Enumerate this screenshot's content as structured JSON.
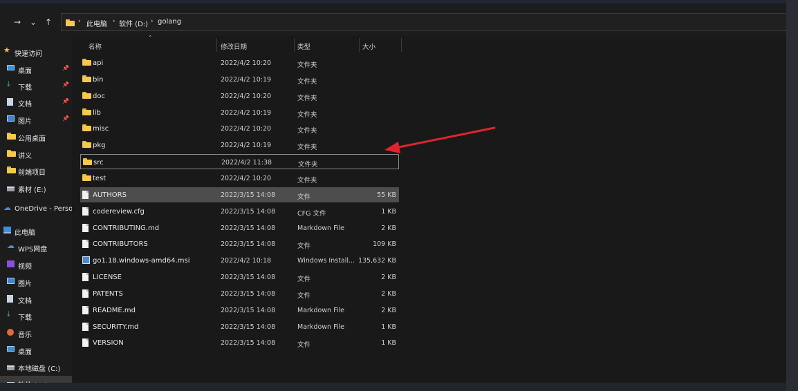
{
  "nav": {
    "back_icon": "arrow-right",
    "recent_icon": "chevron-down",
    "up_icon": "arrow-up"
  },
  "address": {
    "segments": [
      "此电脑",
      "软件 (D:)",
      "golang"
    ]
  },
  "sidebar": {
    "items": [
      {
        "label": "快速访问",
        "icon": "star"
      },
      {
        "label": "桌面",
        "icon": "desktop",
        "pinned": "📌"
      },
      {
        "label": "下载",
        "icon": "download",
        "pinned": "📌"
      },
      {
        "label": "文档",
        "icon": "document",
        "pinned": "📌"
      },
      {
        "label": "图片",
        "icon": "picture",
        "pinned": "📌"
      },
      {
        "label": "公用桌面",
        "icon": "folder"
      },
      {
        "label": "讲义",
        "icon": "folder"
      },
      {
        "label": "前端项目",
        "icon": "folder"
      },
      {
        "label": "素材 (E:)",
        "icon": "drive"
      },
      {
        "label": "OneDrive - Persor",
        "icon": "cloud"
      },
      {
        "label": "此电脑",
        "icon": "computer"
      },
      {
        "label": "WPS网盘",
        "icon": "cloud"
      },
      {
        "label": "视频",
        "icon": "video"
      },
      {
        "label": "图片",
        "icon": "picture"
      },
      {
        "label": "文档",
        "icon": "document"
      },
      {
        "label": "下载",
        "icon": "download"
      },
      {
        "label": "音乐",
        "icon": "music"
      },
      {
        "label": "桌面",
        "icon": "desktop"
      },
      {
        "label": "本地磁盘 (C:)",
        "icon": "drive"
      },
      {
        "label": "软件 (D:)",
        "icon": "drive"
      }
    ]
  },
  "columns": {
    "name": "名称",
    "date": "修改日期",
    "type": "类型",
    "size": "大小"
  },
  "files": [
    {
      "name": "api",
      "date": "2022/4/2 10:20",
      "type": "文件夹",
      "size": "",
      "kind": "folder"
    },
    {
      "name": "bin",
      "date": "2022/4/2 10:19",
      "type": "文件夹",
      "size": "",
      "kind": "folder"
    },
    {
      "name": "doc",
      "date": "2022/4/2 10:20",
      "type": "文件夹",
      "size": "",
      "kind": "folder"
    },
    {
      "name": "lib",
      "date": "2022/4/2 10:19",
      "type": "文件夹",
      "size": "",
      "kind": "folder"
    },
    {
      "name": "misc",
      "date": "2022/4/2 10:20",
      "type": "文件夹",
      "size": "",
      "kind": "folder"
    },
    {
      "name": "pkg",
      "date": "2022/4/2 10:19",
      "type": "文件夹",
      "size": "",
      "kind": "folder"
    },
    {
      "name": "src",
      "date": "2022/4/2 11:38",
      "type": "文件夹",
      "size": "",
      "kind": "folder"
    },
    {
      "name": "test",
      "date": "2022/4/2 10:20",
      "type": "文件夹",
      "size": "",
      "kind": "folder"
    },
    {
      "name": "AUTHORS",
      "date": "2022/3/15 14:08",
      "type": "文件",
      "size": "55 KB",
      "kind": "file"
    },
    {
      "name": "codereview.cfg",
      "date": "2022/3/15 14:08",
      "type": "CFG 文件",
      "size": "1 KB",
      "kind": "file"
    },
    {
      "name": "CONTRIBUTING.md",
      "date": "2022/3/15 14:08",
      "type": "Markdown File",
      "size": "2 KB",
      "kind": "file"
    },
    {
      "name": "CONTRIBUTORS",
      "date": "2022/3/15 14:08",
      "type": "文件",
      "size": "109 KB",
      "kind": "file"
    },
    {
      "name": "go1.18.windows-amd64.msi",
      "date": "2022/4/2 10:18",
      "type": "Windows Install...",
      "size": "135,632 KB",
      "kind": "msi"
    },
    {
      "name": "LICENSE",
      "date": "2022/3/15 14:08",
      "type": "文件",
      "size": "2 KB",
      "kind": "file"
    },
    {
      "name": "PATENTS",
      "date": "2022/3/15 14:08",
      "type": "文件",
      "size": "2 KB",
      "kind": "file"
    },
    {
      "name": "README.md",
      "date": "2022/3/15 14:08",
      "type": "Markdown File",
      "size": "2 KB",
      "kind": "file"
    },
    {
      "name": "SECURITY.md",
      "date": "2022/3/15 14:08",
      "type": "Markdown File",
      "size": "1 KB",
      "kind": "file"
    },
    {
      "name": "VERSION",
      "date": "2022/3/15 14:08",
      "type": "文件",
      "size": "1 KB",
      "kind": "file"
    }
  ],
  "state": {
    "focused_row": "src",
    "selected_row": "AUTHORS"
  },
  "colors": {
    "annotation_arrow": "#e0242b",
    "folder": "#f6c94d"
  }
}
